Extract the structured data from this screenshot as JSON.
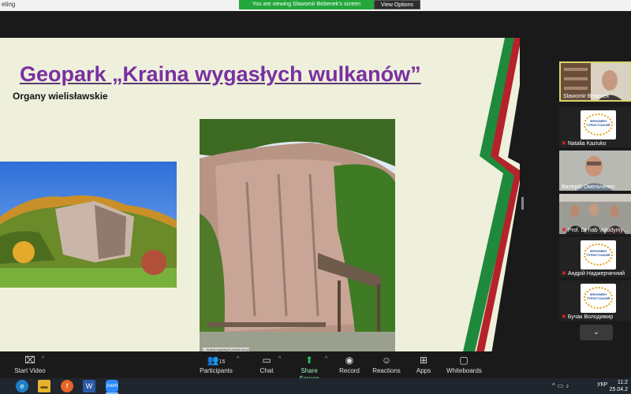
{
  "window": {
    "app_title": "eting"
  },
  "banner": {
    "message": "You are viewing Slawomir Bebenek's screen",
    "options_label": "View Options"
  },
  "slide": {
    "title": "Geopark „Kraina wygasłych wulkanów”",
    "subtitle": "Organy wielisławskie",
    "photo_caption": "… kraina-wygaslych-wulkanow.pl"
  },
  "participants": [
    {
      "name": "Slawomir Bebenek",
      "type": "video",
      "muted": false
    },
    {
      "name": "Natalia Kaziuko",
      "type": "badge",
      "muted": true
    },
    {
      "name": "Валерій Омельченко",
      "type": "video",
      "muted": false
    },
    {
      "name": "Prof. Dr hab Volodymy…",
      "type": "video",
      "muted": true
    },
    {
      "name": "Андрій Наджерчичний",
      "type": "badge",
      "muted": true
    },
    {
      "name": "Бучак Володимир",
      "type": "badge",
      "muted": true
    }
  ],
  "badge_text": "ФЕНОМЕН ТУРИСТСЬКИЙ",
  "toolbar": {
    "start_video": "Start Video",
    "participants": "Participants",
    "participants_count": "16",
    "chat": "Chat",
    "share_screen": "Share Screen",
    "record": "Record",
    "reactions": "Reactions",
    "apps": "Apps",
    "whiteboards": "Whiteboards"
  },
  "taskbar": {
    "lang": "УКР",
    "time": "11:2",
    "date": "25.04.2"
  },
  "colors": {
    "slide_title": "#7a2fa0",
    "stripe_green": "#1f8a3c",
    "stripe_red": "#b5222a",
    "stripe_black": "#1a1a1a",
    "share_green": "#23c35b"
  }
}
